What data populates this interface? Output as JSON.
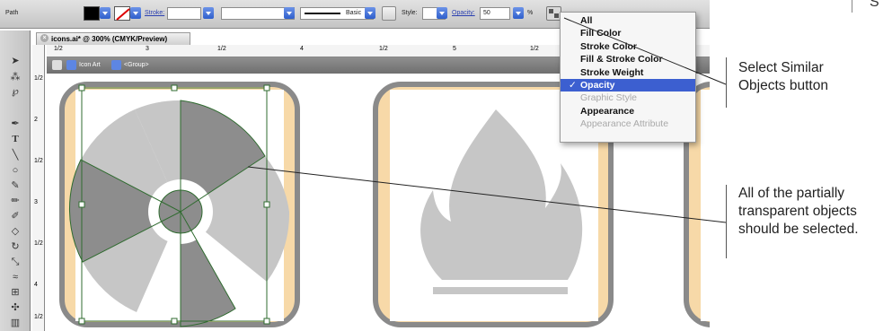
{
  "control_bar": {
    "selection_type": "Path",
    "stroke_label": "Stroke:",
    "stroke_profile": "Basic",
    "style_label": "Style:",
    "opacity_label": "Opacity:",
    "opacity_value": "50",
    "percent": "%"
  },
  "document": {
    "tab_title": "icons.ai* @ 300% (CMYK/Preview)",
    "isolation": {
      "layer": "Icon Art",
      "group": "<Group>"
    },
    "ruler_top": [
      "1/2",
      "3",
      "1/2",
      "4",
      "1/2",
      "5",
      "1/2"
    ],
    "ruler_left": [
      "1/2",
      "2",
      "1/2",
      "3",
      "1/2",
      "4",
      "1/2"
    ]
  },
  "select_similar_menu": {
    "items": [
      {
        "label": "All",
        "state": "normal"
      },
      {
        "label": "Fill Color",
        "state": "normal"
      },
      {
        "label": "Stroke Color",
        "state": "normal"
      },
      {
        "label": "Fill & Stroke Color",
        "state": "normal"
      },
      {
        "label": "Stroke Weight",
        "state": "normal"
      },
      {
        "label": "Opacity",
        "state": "selected"
      },
      {
        "label": "Graphic Style",
        "state": "disabled"
      },
      {
        "label": "Appearance",
        "state": "normal"
      },
      {
        "label": "Appearance Attribute",
        "state": "disabled"
      }
    ]
  },
  "callouts": {
    "button": [
      "Select Similar",
      "Objects button"
    ],
    "objects": [
      "All of the partially",
      "transparent objects",
      "should be selected."
    ]
  },
  "page_marker": "S",
  "colors": {
    "menu_highlight": "#3c5fd0",
    "icon_frame": "#8a8a8a",
    "icon_bg": "#f7d9a8",
    "selection": "#2f6b2f",
    "dark_wedge": "#8d8d8d",
    "light_wedge": "#c6c6c6"
  }
}
